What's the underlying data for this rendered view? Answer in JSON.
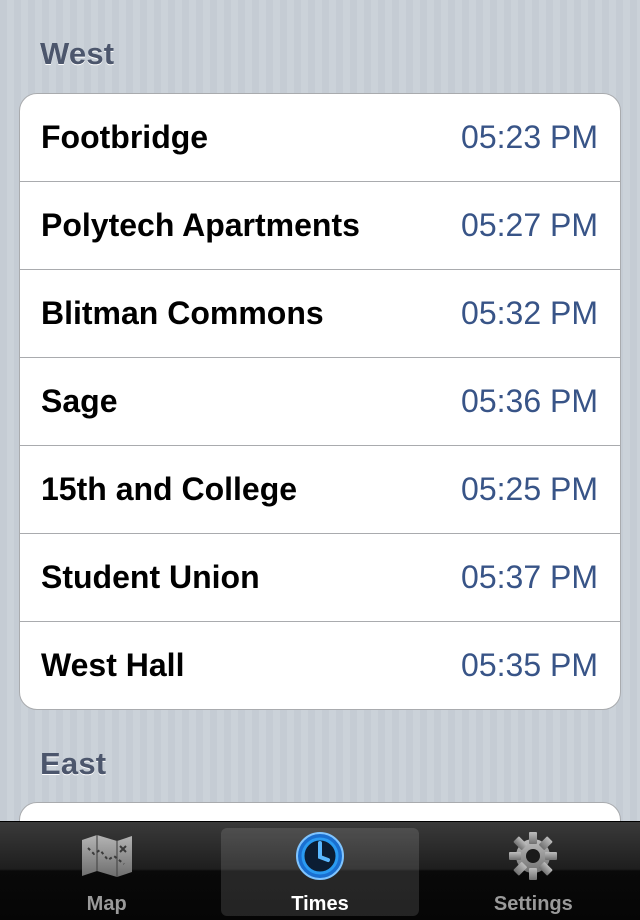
{
  "sections": [
    {
      "title": "West",
      "stops": [
        {
          "name": "Footbridge",
          "time": "05:23 PM"
        },
        {
          "name": "Polytech Apartments",
          "time": "05:27 PM"
        },
        {
          "name": "Blitman Commons",
          "time": "05:32 PM"
        },
        {
          "name": "Sage",
          "time": "05:36 PM"
        },
        {
          "name": "15th and College",
          "time": "05:25 PM"
        },
        {
          "name": "Student Union",
          "time": "05:37 PM"
        },
        {
          "name": "West Hall",
          "time": "05:35 PM"
        }
      ]
    },
    {
      "title": "East",
      "stops": []
    }
  ],
  "tabbar": {
    "tabs": [
      {
        "label": "Map",
        "icon": "map-icon",
        "selected": false
      },
      {
        "label": "Times",
        "icon": "clock-icon",
        "selected": true
      },
      {
        "label": "Settings",
        "icon": "gear-icon",
        "selected": false
      }
    ]
  },
  "colors": {
    "section_header": "#4c566c",
    "time_text": "#385487",
    "selected_tab_accent": "#2a9bf2"
  }
}
